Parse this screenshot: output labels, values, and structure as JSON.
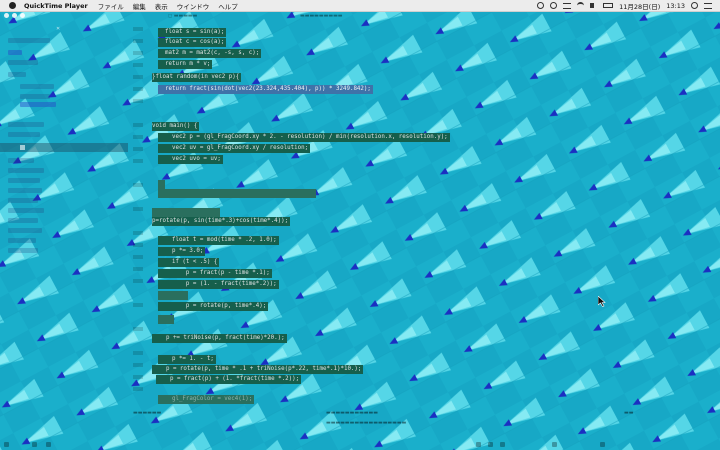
{
  "menubar": {
    "app_name": "QuickTime Player",
    "menus": [
      "ファイル",
      "編集",
      "表示",
      "ウインドウ",
      "ヘルプ"
    ],
    "date": "11月28日(日)",
    "time": "13:13"
  },
  "code_lines": [
    "  float s = sin(a);",
    "  float c = cos(a);",
    "  mat2 m = mat2(c, -s, s, c);",
    "  return m * v;",
    "}float random(in vec2 p){",
    "  return fract(sin(dot(vec2(23.324,435.404), p)) * 3249.842);",
    "void main() {",
    "    vec2 p = (gl_FragCoord.xy * 2. - resolution) / min(resolution.x, resolution.y);",
    "    vec2 uv = gl_FragCoord.xy / resolution;",
    "    vec2 uvo = uv;",
    "",
    "p=rotate(p, sin(time*.3)+cos(time*.4));",
    "    float t = mod(time * .2, 1.0);",
    "    p *= 3.0;",
    "    if (t < .5) {",
    "        p = fract(p - time *.1);",
    "        p = (1. - fract(time*.2));",
    "        p = rotate(p, time*.4);",
    "    p += triNoise(p, fract(time)*20.);",
    "    p *= 1. - t;",
    "    p = rotate(p, time * .1 + triNoise(p*.22, time*.1)*10.);",
    "    p = fract(p) + (1. *fract(time *.2));",
    "    gl_FragColor = vec4(1);"
  ]
}
